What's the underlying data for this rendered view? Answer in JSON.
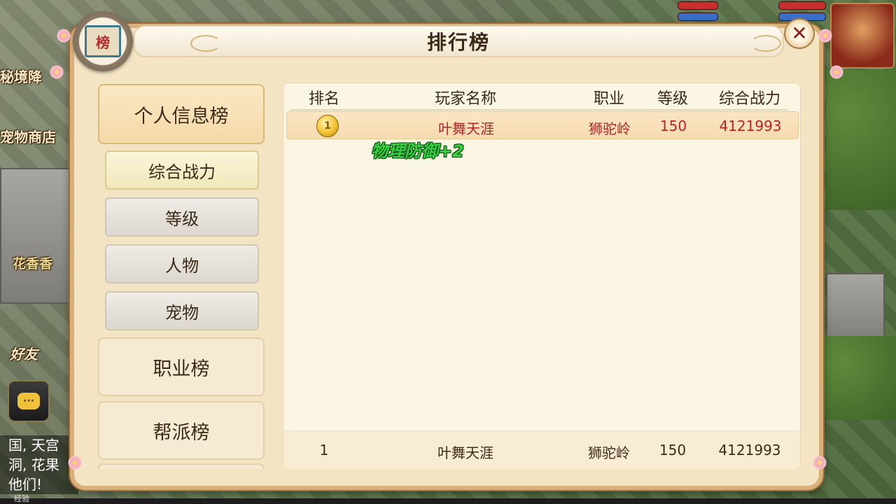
{
  "panel": {
    "title": "排行榜",
    "badge_char": "榜",
    "close_label": "✕"
  },
  "left_nav": {
    "categories": [
      {
        "label": "个人信息榜",
        "active": true
      },
      {
        "label": "职业榜",
        "active": false
      },
      {
        "label": "帮派榜",
        "active": false
      }
    ],
    "subtabs": [
      {
        "label": "综合战力",
        "active": true
      },
      {
        "label": "等级",
        "active": false
      },
      {
        "label": "人物",
        "active": false
      },
      {
        "label": "宠物",
        "active": false
      }
    ]
  },
  "ranking": {
    "columns": [
      "排名",
      "玩家名称",
      "职业",
      "等级",
      "综合战力"
    ],
    "rows": [
      {
        "rank": "1",
        "name": "叶舞天涯",
        "class": "狮驼岭",
        "level": "150",
        "power": "4121993"
      }
    ],
    "my_rank": {
      "rank": "1",
      "name": "叶舞天涯",
      "class": "狮驼岭",
      "level": "150",
      "power": "4121993"
    }
  },
  "floating_text": "物理防御+2",
  "background": {
    "labels": {
      "secret_realm": "秘境降",
      "pet_shop": "宠物商店",
      "npc_name": "花香香",
      "friends": "好友",
      "experience": "经验"
    },
    "chat_text": "国, 天宫\n洞, 花果\n他们!",
    "chat_icon": "···"
  },
  "colors": {
    "highlight_text": "#b8232a",
    "panel_bg": "#f3e4c4",
    "float_text": "#35d23e"
  }
}
